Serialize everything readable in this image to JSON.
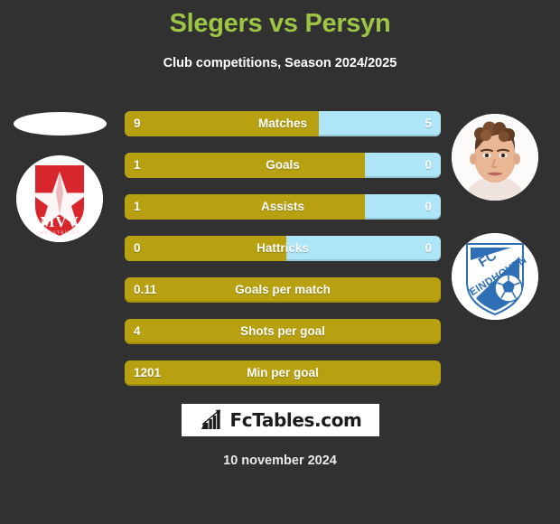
{
  "header": {
    "title": "Slegers vs Persyn",
    "subtitle": "Club competitions, Season 2024/2025",
    "title_color": "#9dc544"
  },
  "colors": {
    "background": "#313131",
    "home_bar": "#b8a111",
    "away_bar": "#aee6f7",
    "text": "#ffffff"
  },
  "media": {
    "left_photo_placeholder": "blank-player-photo",
    "left_badge": {
      "name": "MVV Maastricht",
      "primary_text": "MVV",
      "secondary_text": "MAASTRICHT",
      "shield_color": "#d8262d",
      "star_color": "#ffffff"
    },
    "right_photo": {
      "name": "player-portrait-persyn"
    },
    "right_badge": {
      "name": "FC Eindhoven",
      "line1": "FC",
      "line2": "EINDHOVEN",
      "shield_color": "#2f6fb5",
      "stripe_color": "#ffffff"
    }
  },
  "chart_data": {
    "type": "bar",
    "title": "Slegers vs Persyn",
    "subtitle": "Club competitions, Season 2024/2025",
    "orientation": "horizontal-diverging",
    "series": [
      {
        "name": "Slegers",
        "side": "left",
        "color": "#b8a111"
      },
      {
        "name": "Persyn",
        "side": "right",
        "color": "#aee6f7"
      }
    ],
    "categories": [
      "Matches",
      "Goals",
      "Assists",
      "Hattricks",
      "Goals per match",
      "Shots per goal",
      "Min per goal"
    ],
    "rows": [
      {
        "label": "Matches",
        "left_value": "9",
        "right_value": "5",
        "left_pct": 61.5,
        "has_right": true
      },
      {
        "label": "Goals",
        "left_value": "1",
        "right_value": "0",
        "left_pct": 76.0,
        "has_right": true
      },
      {
        "label": "Assists",
        "left_value": "1",
        "right_value": "0",
        "left_pct": 76.0,
        "has_right": true
      },
      {
        "label": "Hattricks",
        "left_value": "0",
        "right_value": "0",
        "left_pct": 51.0,
        "has_right": true
      },
      {
        "label": "Goals per match",
        "left_value": "0.11",
        "right_value": "",
        "left_pct": 100,
        "has_right": false
      },
      {
        "label": "Shots per goal",
        "left_value": "4",
        "right_value": "",
        "left_pct": 100,
        "has_right": false
      },
      {
        "label": "Min per goal",
        "left_value": "1201",
        "right_value": "",
        "left_pct": 100,
        "has_right": false
      }
    ]
  },
  "footer": {
    "logo_text": "FcTables.com",
    "logo_icon": "bar-chart-arrow-icon",
    "date": "10 november 2024"
  }
}
